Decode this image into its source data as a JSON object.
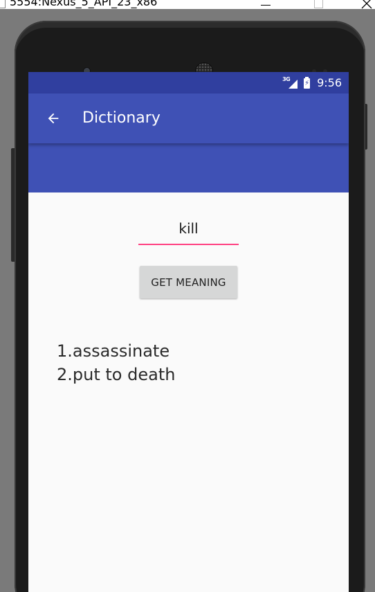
{
  "window": {
    "title": "5554:Nexus_5_API_23_x86",
    "minimize_icon": "minimize-icon",
    "maximize_icon": "maximize-icon",
    "close_icon": "close-icon"
  },
  "status_bar": {
    "network_label": "3G",
    "time": "9:56",
    "signal_icon": "signal-icon",
    "battery_icon": "battery-charging-icon"
  },
  "app_bar": {
    "back_icon": "arrow-back-icon",
    "title": "Dictionary"
  },
  "form": {
    "word_value": "kill",
    "button_label": "GET MEANING"
  },
  "results": {
    "meanings": [
      "1.assassinate",
      "2.put to death"
    ]
  },
  "colors": {
    "status_bar": "#303f9f",
    "primary": "#3f51b5",
    "accent": "#ff4081",
    "button": "#d6d7d7",
    "background": "#fafafa"
  }
}
